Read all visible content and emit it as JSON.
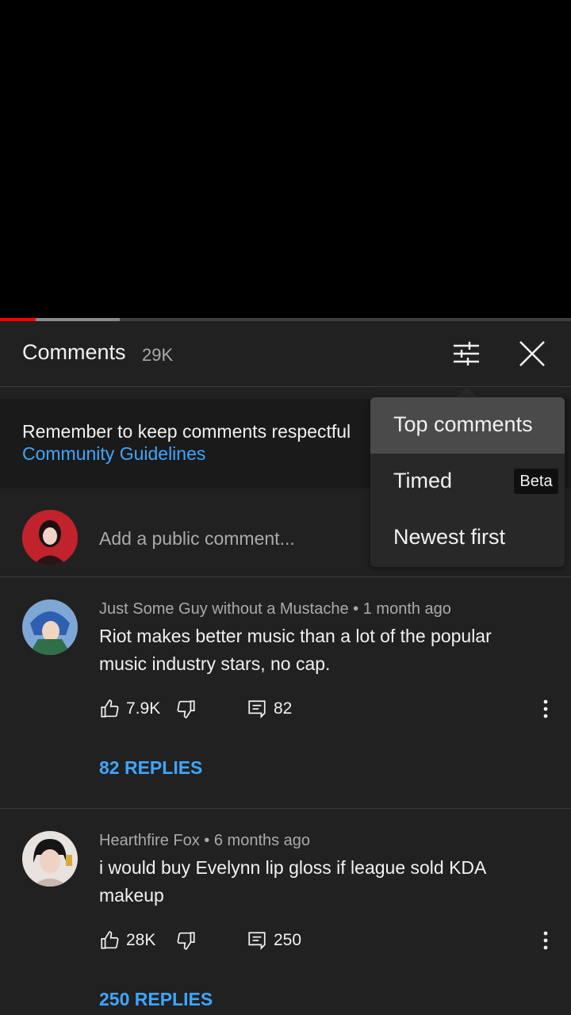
{
  "video": {
    "played_fraction": 0.063,
    "buffered_fraction": 0.21
  },
  "header": {
    "title": "Comments",
    "count": "29K",
    "filter_icon": "sort-filter-icon",
    "close_icon": "close-icon"
  },
  "notice": {
    "text": "Remember to keep comments respectful",
    "link": "Community Guidelines"
  },
  "add_comment": {
    "placeholder": "Add a public comment..."
  },
  "sort_menu": {
    "items": [
      {
        "label": "Top comments",
        "selected": true
      },
      {
        "label": "Timed",
        "badge": "Beta"
      },
      {
        "label": "Newest first"
      }
    ]
  },
  "comments": [
    {
      "author": "Just Some Guy without a Mustache",
      "separator": "•",
      "time": "1 month ago",
      "text": "Riot makes better music than a lot of the popular music industry stars, no cap.",
      "likes": "7.9K",
      "reply_count": "82",
      "replies_link": "82 REPLIES"
    },
    {
      "author": "Hearthfire Fox",
      "separator": "•",
      "time": "6 months ago",
      "text": "i would buy Evelynn lip gloss if league sold KDA makeup",
      "likes": "28K",
      "reply_count": "250",
      "replies_link": "250 REPLIES"
    }
  ],
  "colors": {
    "link": "#3ea6ff",
    "panel": "#212121",
    "progress": "#ff0000"
  }
}
